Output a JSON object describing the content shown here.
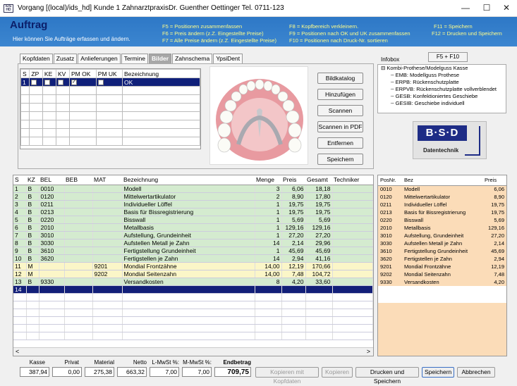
{
  "window": {
    "app_icon_text": "IDS HD",
    "title": "Vorgang [(local)/ids_hd] Kunde 1 ZahnarztpraxisDr. Guenther Oettinger Tel. 0711-123",
    "min": "—",
    "max": "☐",
    "close": "✕"
  },
  "header": {
    "title": "Auftrag",
    "subtitle": "Hier können Sie Aufträge erfassen und ändern.",
    "hotkeys": [
      "F5 = Positionen zusammenfassen",
      "F6 = Preis ändern (z.Z. Eingestellte Preise)",
      "F7 = Alle Preise ändern (z.Z. Eingestellte Preise)",
      "F8 = Kopfbereich verkleinern.",
      "F9 = Positionen nach OK und UK zusammenfassen",
      "F10 = Positionen nach Druck-Nr. sortieren",
      "F11 = Speichern",
      "F12 = Drucken und Speichern"
    ]
  },
  "tabs": [
    "Kopfdaten",
    "Zusatz",
    "Anlieferungen",
    "Termine",
    "Bilder",
    "Zahnschema",
    "YpsiDent"
  ],
  "active_tab": "Bilder",
  "upper_grid": {
    "headers": [
      "S",
      "ZP",
      "KE",
      "KV",
      "PM OK",
      "PM UK",
      "Bezeichnung"
    ],
    "rows": [
      {
        "s": "1",
        "bezeichnung": "OK"
      }
    ]
  },
  "image_buttons": [
    "Bildkatalog",
    "Hinzufügen",
    "Scannen",
    "Scannen in PDF",
    "Entfernen",
    "Speichern"
  ],
  "infobox": {
    "label": "Infobox",
    "button": "F5 + F10",
    "tree_root": "Kombi-Prothese/Modelguss Kasse",
    "tree_items": [
      "EMB:  Modellguss Prothese",
      "ERPB:  Rückenschutzplatte",
      "ERPVB:  Rückenschutzplatte vollverblendet",
      "GESB:  Konfektioniertes Geschiebe",
      "GESIB:  Geschiebe individuell"
    ]
  },
  "logo": {
    "text": "B·S·D",
    "caption": "Datentechnik"
  },
  "main_table": {
    "headers": [
      "S",
      "KZ",
      "BEL",
      "BEB",
      "MAT",
      "Bezeichnung",
      "Menge",
      "Preis",
      "Gesamt",
      "Techniker"
    ],
    "rows": [
      [
        "1",
        "B",
        "0010",
        "",
        "",
        "Modell",
        "3",
        "6,06",
        "18,18",
        ""
      ],
      [
        "2",
        "B",
        "0120",
        "",
        "",
        "Mittelwertartikulator",
        "2",
        "8,90",
        "17,80",
        ""
      ],
      [
        "3",
        "B",
        "0211",
        "",
        "",
        "Individueller Löffel",
        "1",
        "19,75",
        "19,75",
        ""
      ],
      [
        "4",
        "B",
        "0213",
        "",
        "",
        "Basis für Bissregistrierung",
        "1",
        "19,75",
        "19,75",
        ""
      ],
      [
        "5",
        "B",
        "0220",
        "",
        "",
        "Bisswall",
        "1",
        "5,69",
        "5,69",
        ""
      ],
      [
        "6",
        "B",
        "2010",
        "",
        "",
        "Metallbasis",
        "1",
        "129,16",
        "129,16",
        ""
      ],
      [
        "7",
        "B",
        "3010",
        "",
        "",
        "Aufstellung, Grundeinheit",
        "1",
        "27,20",
        "27,20",
        ""
      ],
      [
        "8",
        "B",
        "3030",
        "",
        "",
        "Aufstellen Metall je Zahn",
        "14",
        "2,14",
        "29,96",
        ""
      ],
      [
        "9",
        "B",
        "3610",
        "",
        "",
        "Fertigstellung Grundeinheit",
        "1",
        "45,69",
        "45,69",
        ""
      ],
      [
        "10",
        "B",
        "3620",
        "",
        "",
        "Fertigstellen je Zahn",
        "14",
        "2,94",
        "41,16",
        ""
      ],
      [
        "11",
        "M",
        "",
        "",
        "9201",
        "Mondial Frontzähne",
        "14,00",
        "12,19",
        "170,66",
        ""
      ],
      [
        "12",
        "M",
        "",
        "",
        "9202",
        "Mondial Seitenzahn",
        "14,00",
        "7,48",
        "104,72",
        ""
      ],
      [
        "13",
        "B",
        "9330",
        "",
        "",
        "Versandkosten",
        "8",
        "4,20",
        "33,60",
        ""
      ],
      [
        "14",
        "",
        "",
        "",
        "",
        "",
        "",
        "",
        "",
        ""
      ]
    ],
    "row_colors": [
      "green",
      "green",
      "green",
      "green",
      "green",
      "green",
      "green",
      "green",
      "green",
      "green",
      "yellow",
      "yellow",
      "green",
      "selected"
    ]
  },
  "price_list": {
    "headers": [
      "PosNr.",
      "Bez",
      "Preis"
    ],
    "rows": [
      [
        "0010",
        "Modell",
        "6,06"
      ],
      [
        "0120",
        "Mittelwertartikulator",
        "8,90"
      ],
      [
        "0211",
        "Individueller Löffel",
        "19,75"
      ],
      [
        "0213",
        "Basis für Bissregistrierung",
        "19,75"
      ],
      [
        "0220",
        "Bisswall",
        "5,69"
      ],
      [
        "2010",
        "Metallbasis",
        "129,16"
      ],
      [
        "3010",
        "Aufstellung, Grundeinheit",
        "27,20"
      ],
      [
        "3030",
        "Aufstellen Metall je Zahn",
        "2,14"
      ],
      [
        "3610",
        "Fertigstellung Grundeinheit",
        "45,69"
      ],
      [
        "3620",
        "Fertigstellen je Zahn",
        "2,94"
      ],
      [
        "9201",
        "Mondial Frontzähne",
        "12,19"
      ],
      [
        "9202",
        "Mondial Seitenzahn",
        "7,48"
      ],
      [
        "9330",
        "Versandkosten",
        "4,20"
      ]
    ]
  },
  "totals": {
    "kasse_label": "Kasse",
    "kasse": "387,94",
    "privat_label": "Privat",
    "privat": "0,00",
    "material_label": "Material",
    "material": "275,38",
    "netto_label": "Netto",
    "netto": "663,32",
    "lmwst_label": "L-MwSt %:",
    "lmwst": "7,00",
    "mmwst_label": "M-MwSt %:",
    "mmwst": "7,00",
    "end_label": "Endbetrag",
    "end": "709,75"
  },
  "footer_buttons": {
    "kopieren_kopf": "Kopieren mit Kopfdaten",
    "kopieren": "Kopieren",
    "drucken": "Drucken und Speichern",
    "speichern": "Speichern",
    "abbrechen": "Abbrechen"
  },
  "scroll": {
    "left": "<",
    "right": ">"
  }
}
